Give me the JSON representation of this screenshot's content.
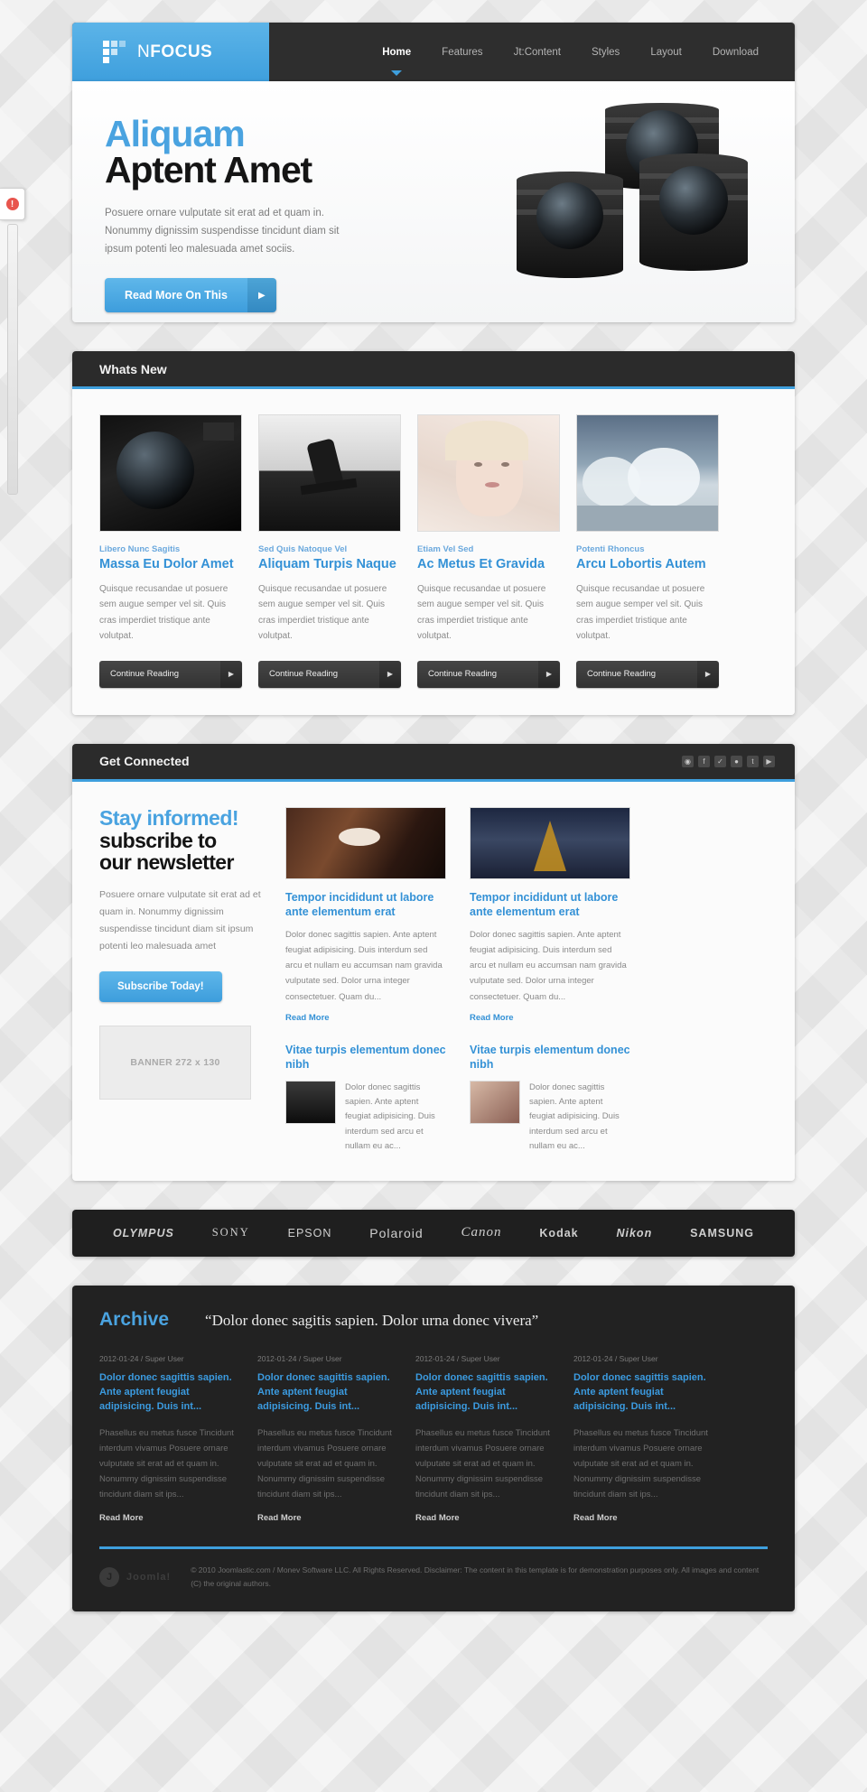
{
  "header": {
    "brand_prefix": "N",
    "brand_bold": "FOCUS",
    "logo_icon": "pixel-grid-icon",
    "nav": [
      {
        "label": "Home",
        "active": true
      },
      {
        "label": "Features",
        "active": false
      },
      {
        "label": "Jt:Content",
        "active": false
      },
      {
        "label": "Styles",
        "active": false
      },
      {
        "label": "Layout",
        "active": false
      },
      {
        "label": "Download",
        "active": false
      }
    ]
  },
  "edge": {
    "badge": "!"
  },
  "hero": {
    "title_blue": "Aliquam",
    "title_black": "Aptent Amet",
    "paragraph": "Posuere ornare vulputate sit erat ad et quam in. Nonummy dignissim suspendisse tincidunt diam sit ipsum potenti leo malesuada amet sociis.",
    "button_label": "Read More On This",
    "button_arrow": "▶"
  },
  "whats_new": {
    "heading": "Whats New",
    "cards": [
      {
        "kicker": "Libero Nunc Sagitis",
        "title": "Massa Eu Dolor Amet",
        "text": "Quisque recusandae ut posuere sem augue semper vel sit. Quis cras imperdiet tristique ante volutpat.",
        "button": "Continue Reading",
        "image": "camera-lens-photo"
      },
      {
        "kicker": "Sed Quis Natoque Vel",
        "title": "Aliquam Turpis Naque",
        "text": "Quisque recusandae ut posuere sem augue semper vel sit. Quis cras imperdiet tristique ante volutpat.",
        "button": "Continue Reading",
        "image": "skateboarder-photo"
      },
      {
        "kicker": "Etiam Vel Sed",
        "title": "Ac Metus Et Gravida",
        "text": "Quisque recusandae ut posuere sem augue semper vel sit. Quis cras imperdiet tristique ante volutpat.",
        "button": "Continue Reading",
        "image": "blonde-woman-portrait-photo"
      },
      {
        "kicker": "Potenti Rhoncus",
        "title": "Arcu Lobortis Autem",
        "text": "Quisque recusandae ut posuere sem augue semper vel sit. Quis cras imperdiet tristique ante volutpat.",
        "button": "Continue Reading",
        "image": "snowy-trees-photo"
      }
    ]
  },
  "get_connected": {
    "heading": "Get Connected",
    "social_icons": [
      "rss-icon",
      "facebook-icon",
      "twitter-icon",
      "flickr-icon",
      "tumblr-icon",
      "youtube-icon"
    ],
    "social_glyphs": [
      "◉",
      "f",
      "✓",
      "●",
      "t",
      "▶"
    ],
    "newsletter": {
      "title_blue": "Stay informed!",
      "title_line2": "subscribe to",
      "title_line3": "our newsletter",
      "paragraph": "Posuere ornare vulputate sit erat ad et quam in. Nonummy dignissim suspendisse tincidunt diam sit ipsum potenti leo malesuada amet",
      "button_label": "Subscribe Today!",
      "banner_label": "BANNER 272 x 130"
    },
    "columns": [
      {
        "image": "eye-behind-hair-photo",
        "title": "Tempor incididunt ut labore ante elementum erat",
        "text": "Dolor donec sagittis sapien. Ante aptent feugiat adipisicing. Duis interdum sed arcu et nullam eu accumsan nam gravida vulputate sed. Dolor urna integer consectetuer. Quam du...",
        "read_more": "Read More",
        "sub_title": "Vitae turpis elementum donec nibh",
        "sub_text": "Dolor donec sagittis sapien. Ante aptent feugiat adipisicing. Duis interdum sed arcu et nullam eu ac...",
        "sub_image": "dark-archway-photo"
      },
      {
        "image": "eiffel-tower-night-photo",
        "title": "Tempor incididunt ut labore ante elementum erat",
        "text": "Dolor donec sagittis sapien. Ante aptent feugiat adipisicing. Duis interdum sed arcu et nullam eu accumsan nam gravida vulputate sed. Dolor urna integer consectetuer. Quam du...",
        "read_more": "Read More",
        "sub_title": "Vitae turpis elementum donec nibh",
        "sub_text": "Dolor donec sagittis sapien. Ante aptent feugiat adipisicing. Duis interdum sed arcu et nullam eu ac...",
        "sub_image": "woman-face-closeup-photo"
      }
    ]
  },
  "brands": [
    "OLYMPUS",
    "SONY",
    "EPSON",
    "Polaroid",
    "Canon",
    "Kodak",
    "Nikon",
    "SAMSUNG"
  ],
  "archive": {
    "heading": "Archive",
    "quote": "“Dolor donec sagitis sapien. Dolor urna donec vivera”",
    "columns": [
      {
        "meta": "2012-01-24 / Super User",
        "title": "Dolor donec sagittis sapien. Ante aptent feugiat adipisicing. Duis int...",
        "text": "Phasellus eu metus fusce Tincidunt interdum vivamus Posuere ornare vulputate sit erat ad et quam in. Nonummy dignissim suspendisse tincidunt diam sit ips...",
        "read_more": "Read More"
      },
      {
        "meta": "2012-01-24 / Super User",
        "title": "Dolor donec sagittis sapien. Ante aptent feugiat adipisicing. Duis int...",
        "text": "Phasellus eu metus fusce Tincidunt interdum vivamus Posuere ornare vulputate sit erat ad et quam in. Nonummy dignissim suspendisse tincidunt diam sit ips...",
        "read_more": "Read More"
      },
      {
        "meta": "2012-01-24 / Super User",
        "title": "Dolor donec sagittis sapien. Ante aptent feugiat adipisicing. Duis int...",
        "text": "Phasellus eu metus fusce Tincidunt interdum vivamus Posuere ornare vulputate sit erat ad et quam in. Nonummy dignissim suspendisse tincidunt diam sit ips...",
        "read_more": "Read More"
      },
      {
        "meta": "2012-01-24 / Super User",
        "title": "Dolor donec sagittis sapien. Ante aptent feugiat adipisicing. Duis int...",
        "text": "Phasellus eu metus fusce Tincidunt interdum vivamus Posuere ornare vulputate sit erat ad et quam in. Nonummy dignissim suspendisse tincidunt diam sit ips...",
        "read_more": "Read More"
      }
    ],
    "footer_logo": "Joomla!",
    "copyright": "© 2010 Joomlastic.com / Monev Software LLC. All Rights Reserved. Disclaimer: The content in this template is for demonstration purposes only. All images and content (C) the original authors."
  },
  "colors": {
    "accent": "#3e9fdd",
    "dark": "#2b2b2b",
    "link": "#3391d6"
  }
}
